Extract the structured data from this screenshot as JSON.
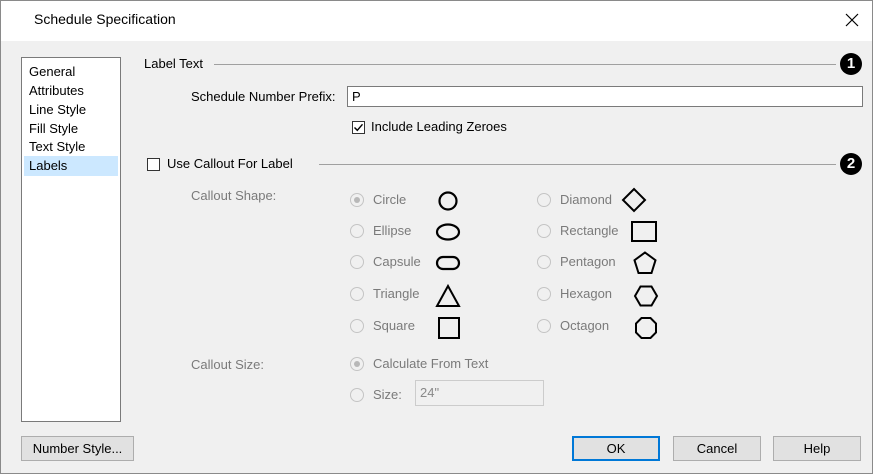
{
  "window": {
    "title": "Schedule Specification"
  },
  "sidebar": {
    "items": [
      {
        "label": "General",
        "selected": false
      },
      {
        "label": "Attributes",
        "selected": false
      },
      {
        "label": "Line Style",
        "selected": false
      },
      {
        "label": "Fill Style",
        "selected": false
      },
      {
        "label": "Text Style",
        "selected": false
      },
      {
        "label": "Labels",
        "selected": true
      }
    ]
  },
  "label_text": {
    "group_label": "Label Text",
    "badge": "1",
    "prefix_label": "Schedule Number Prefix:",
    "prefix_value": "P",
    "leading_zeroes_label": "Include Leading Zeroes",
    "leading_zeroes_checked": true
  },
  "callout": {
    "use_callout_label": "Use Callout For Label",
    "use_callout_checked": false,
    "badge": "2",
    "shape_label": "Callout Shape:",
    "shapes_left": [
      {
        "label": "Circle",
        "selected": true,
        "icon": "circle-icon"
      },
      {
        "label": "Ellipse",
        "selected": false,
        "icon": "ellipse-icon"
      },
      {
        "label": "Capsule",
        "selected": false,
        "icon": "capsule-icon"
      },
      {
        "label": "Triangle",
        "selected": false,
        "icon": "triangle-icon"
      },
      {
        "label": "Square",
        "selected": false,
        "icon": "square-icon"
      }
    ],
    "shapes_right": [
      {
        "label": "Diamond",
        "selected": false,
        "icon": "diamond-icon"
      },
      {
        "label": "Rectangle",
        "selected": false,
        "icon": "rectangle-icon"
      },
      {
        "label": "Pentagon",
        "selected": false,
        "icon": "pentagon-icon"
      },
      {
        "label": "Hexagon",
        "selected": false,
        "icon": "hexagon-icon"
      },
      {
        "label": "Octagon",
        "selected": false,
        "icon": "octagon-icon"
      }
    ],
    "size_label": "Callout Size:",
    "calc_from_text_label": "Calculate From Text",
    "calc_from_text_selected": true,
    "size_option_label": "Size:",
    "size_value": "24\""
  },
  "footer": {
    "number_style_label": "Number Style...",
    "ok_label": "OK",
    "cancel_label": "Cancel",
    "help_label": "Help"
  },
  "colors": {
    "selection": "#cce8ff",
    "default_button_border": "#0078d7",
    "disabled_text": "#7a7a7a"
  }
}
